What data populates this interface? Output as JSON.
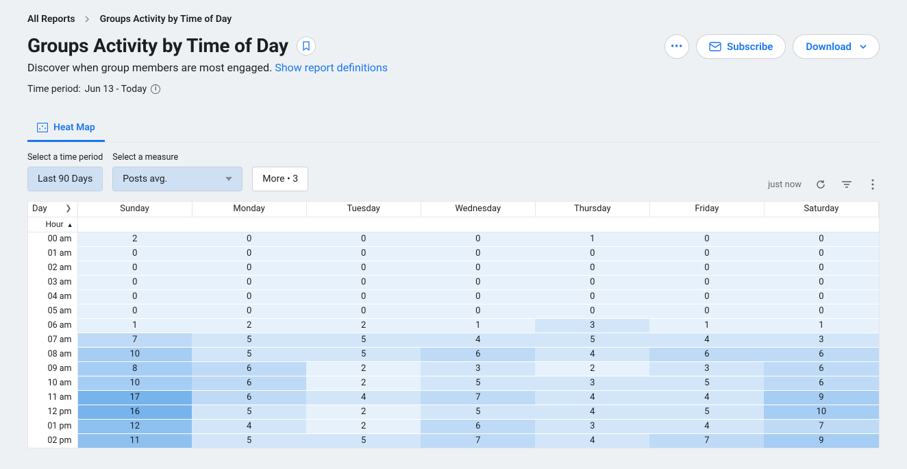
{
  "breadcrumb": {
    "root": "All Reports",
    "current": "Groups Activity by Time of Day"
  },
  "title": "Groups Activity by Time of Day",
  "subtitle": {
    "text": "Discover when group members are most engaged. ",
    "link": "Show report definitions"
  },
  "timeperiod": {
    "label": "Time period: ",
    "value": "Jun 13 - Today"
  },
  "actions": {
    "subscribe": "Subscribe",
    "download": "Download"
  },
  "tabs": {
    "heatmap": "Heat Map"
  },
  "controls": {
    "timeperiod_label": "Select a time period",
    "timeperiod_value": "Last 90 Days",
    "measure_label": "Select a measure",
    "measure_value": "Posts avg.",
    "more_label": "More • 3",
    "timestamp": "just now"
  },
  "table": {
    "corner_day": "Day",
    "corner_hour": "Hour",
    "days": [
      "Sunday",
      "Monday",
      "Tuesday",
      "Wednesday",
      "Thursday",
      "Friday",
      "Saturday"
    ],
    "hours": [
      "00 am",
      "01 am",
      "02 am",
      "03 am",
      "04 am",
      "05 am",
      "06 am",
      "07 am",
      "08 am",
      "09 am",
      "10 am",
      "11 am",
      "12 pm",
      "01 pm",
      "02 pm"
    ]
  },
  "chart_data": {
    "type": "heatmap",
    "xlabel": "Day",
    "ylabel": "Hour",
    "x": [
      "Sunday",
      "Monday",
      "Tuesday",
      "Wednesday",
      "Thursday",
      "Friday",
      "Saturday"
    ],
    "y": [
      "00 am",
      "01 am",
      "02 am",
      "03 am",
      "04 am",
      "05 am",
      "06 am",
      "07 am",
      "08 am",
      "09 am",
      "10 am",
      "11 am",
      "12 pm",
      "01 pm",
      "02 pm"
    ],
    "values": [
      [
        2,
        0,
        0,
        0,
        1,
        0,
        0
      ],
      [
        0,
        0,
        0,
        0,
        0,
        0,
        0
      ],
      [
        0,
        0,
        0,
        0,
        0,
        0,
        0
      ],
      [
        0,
        0,
        0,
        0,
        0,
        0,
        0
      ],
      [
        0,
        0,
        0,
        0,
        0,
        0,
        0
      ],
      [
        0,
        0,
        0,
        0,
        0,
        0,
        0
      ],
      [
        1,
        2,
        2,
        1,
        3,
        1,
        1
      ],
      [
        7,
        5,
        5,
        4,
        5,
        4,
        3
      ],
      [
        10,
        5,
        5,
        6,
        4,
        6,
        6
      ],
      [
        8,
        6,
        2,
        3,
        2,
        3,
        6
      ],
      [
        10,
        6,
        2,
        5,
        3,
        5,
        6
      ],
      [
        17,
        6,
        4,
        7,
        4,
        4,
        9
      ],
      [
        16,
        5,
        2,
        5,
        4,
        5,
        10
      ],
      [
        12,
        4,
        2,
        6,
        3,
        4,
        7
      ],
      [
        11,
        5,
        5,
        7,
        4,
        7,
        9
      ]
    ]
  }
}
